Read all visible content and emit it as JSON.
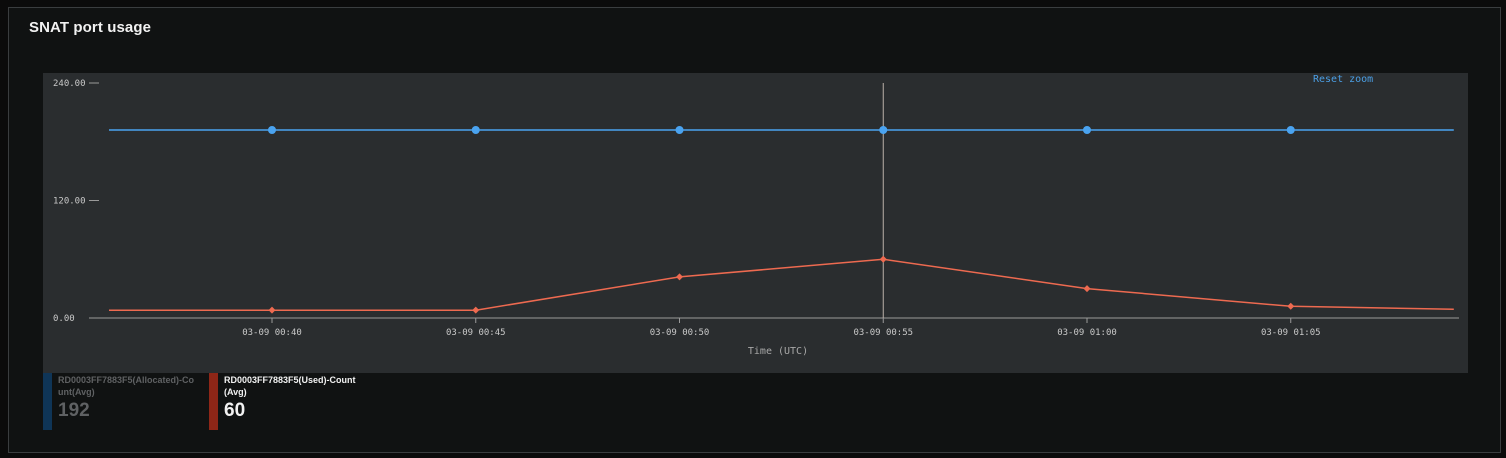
{
  "widget": {
    "title": "SNAT port usage",
    "reset_zoom_label": "Reset zoom"
  },
  "legend": [
    {
      "name": "RD0003FF7883F5(Allocated)-Count(Avg)",
      "value": "192",
      "color": "#0f3557"
    },
    {
      "name": "RD0003FF7883F5(Used)-Count(Avg)",
      "value": "60",
      "color": "#8e2617"
    }
  ],
  "chart_data": {
    "type": "line",
    "title": "SNAT port usage",
    "xlabel": "Time (UTC)",
    "ylabel": "",
    "x_ticks": [
      "03-09 00:40",
      "03-09 00:45",
      "03-09 00:50",
      "03-09 00:55",
      "03-09 01:00",
      "03-09 01:05"
    ],
    "y_ticks": [
      "0.00",
      "120.00",
      "240.00"
    ],
    "ylim": [
      0,
      240
    ],
    "crosshair_x": "03-09 00:55",
    "series": [
      {
        "name": "RD0003FF7883F5(Allocated)-Count(Avg)",
        "color": "#4aa3f0",
        "marker": "circle",
        "x": [
          "03-09 00:36",
          "03-09 00:40",
          "03-09 00:45",
          "03-09 00:50",
          "03-09 00:55",
          "03-09 01:00",
          "03-09 01:05",
          "03-09 01:09"
        ],
        "values": [
          192,
          192,
          192,
          192,
          192,
          192,
          192,
          192
        ],
        "markers": [
          false,
          true,
          true,
          true,
          true,
          true,
          true,
          false
        ]
      },
      {
        "name": "RD0003FF7883F5(Used)-Count(Avg)",
        "color": "#ee6a50",
        "marker": "diamond",
        "x": [
          "03-09 00:36",
          "03-09 00:40",
          "03-09 00:45",
          "03-09 00:50",
          "03-09 00:55",
          "03-09 01:00",
          "03-09 01:05",
          "03-09 01:09"
        ],
        "values": [
          8,
          8,
          8,
          42,
          60,
          30,
          12,
          9
        ],
        "markers": [
          false,
          true,
          true,
          true,
          true,
          true,
          true,
          false
        ]
      }
    ]
  }
}
